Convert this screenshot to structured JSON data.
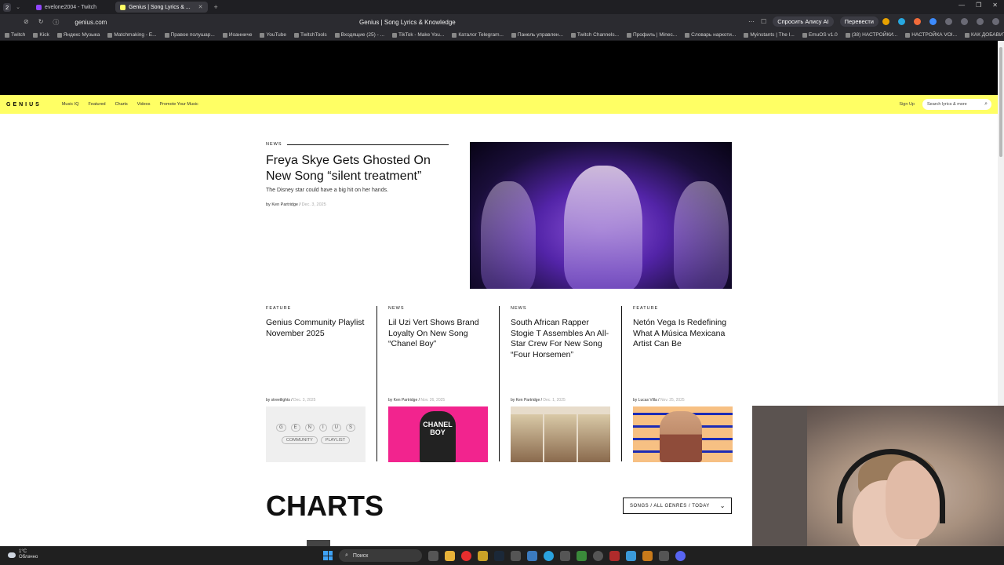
{
  "browser": {
    "profile_badge": "2",
    "tabs": [
      {
        "label": "evelone2004 - Twitch",
        "active": false
      },
      {
        "label": "Genius | Song Lyrics & ...",
        "active": true
      }
    ],
    "url": "genius.com",
    "page_title": "Genius | Song Lyrics & Knowledge",
    "alice_button": "Спросить Алису AI",
    "translate_button": "Перевести",
    "bookmarks": [
      "Twitch",
      "Kick",
      "Яндекс Музыка",
      "Matchmaking - E...",
      "Правое полушар...",
      "Иоанниче",
      "YouTube",
      "TwitchTools",
      "Входящие (25) - ...",
      "TikTok - Make You...",
      "Каталог Telegram...",
      "Панель управлен...",
      "Twitch Channels...",
      "Профиль | Minec...",
      "Словарь наркоти...",
      "Myinstants | The I...",
      "EmuOS v1.0",
      "(38) НАСТРОЙКИ...",
      "НАСТРОЙКА VOI...",
      "КАК ДОБАВИТЬ..."
    ]
  },
  "genius_nav": {
    "logo": "GENIUS",
    "links": [
      "Music IQ",
      "Featured",
      "Charts",
      "Videos",
      "Promote Your Music"
    ],
    "signup": "Sign Up",
    "search_placeholder": "Search lyrics & more"
  },
  "hero": {
    "kicker": "NEWS",
    "title": "Freya Skye Gets Ghosted On New Song “silent treatment”",
    "dek": "The Disney star could have a big hit on her hands.",
    "by_prefix": "by",
    "author": "Ken Partridge",
    "date": "Dec. 3, 2025"
  },
  "cards": [
    {
      "category": "FEATURE",
      "title": "Genius Community Playlist November 2025",
      "author": "streetlights",
      "date": "Dec. 3, 2025",
      "thumb_text": {
        "letters": [
          "G",
          "E",
          "N",
          "I",
          "U",
          "S"
        ],
        "tags": [
          "COMMUNITY",
          "PLAYLIST"
        ]
      }
    },
    {
      "category": "NEWS",
      "title": "Lil Uzi Vert Shows Brand Loyalty On New Song “Chanel Boy”",
      "author": "Ken Partridge",
      "date": "Nov. 26, 2025",
      "thumb_text": "CHANEL BOY"
    },
    {
      "category": "NEWS",
      "title": "South African Rapper Stogie T Assembles An All-Star Crew For New Song “Four Horsemen”",
      "author": "Ken Partridge",
      "date": "Dec. 1, 2025"
    },
    {
      "category": "FEATURE",
      "title": "Netón Vega Is Redefining What A Música Mexicana Artist Can Be",
      "author": "Lucas Villa",
      "date": "Nov. 25, 2025"
    }
  ],
  "charts": {
    "heading": "CHARTS",
    "filter": "SONGS / ALL GENRES / TODAY"
  },
  "taskbar": {
    "temp": "1°C",
    "condition": "Облачно",
    "search": "Поиск"
  },
  "colors": {
    "genius_yellow": "#ffff64",
    "hero_purple": "#5324a8",
    "taskbar": "#202020"
  }
}
